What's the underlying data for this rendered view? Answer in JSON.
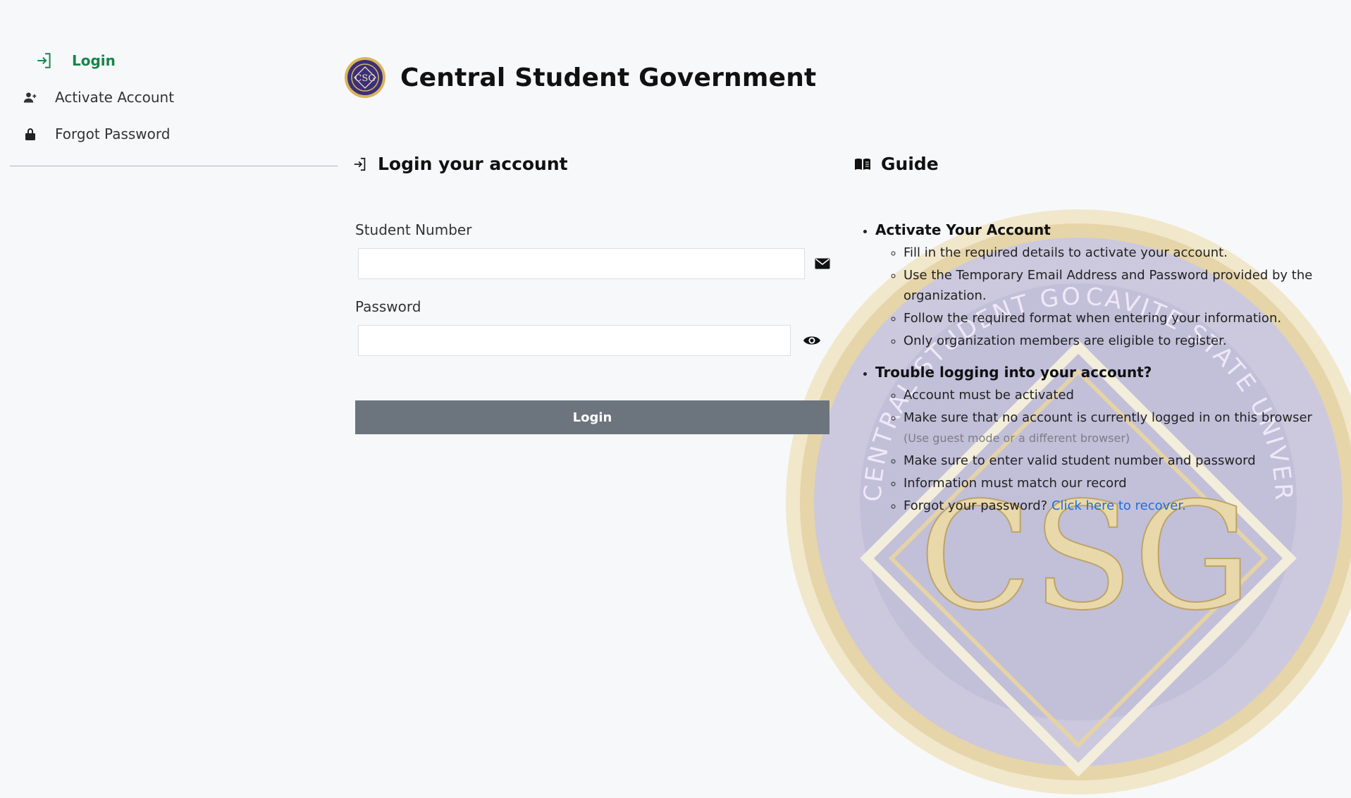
{
  "sidebar": {
    "items": [
      {
        "label": "Login",
        "icon": "login-arrow-icon",
        "active": true
      },
      {
        "label": "Activate Account",
        "icon": "person-add-icon",
        "active": false
      },
      {
        "label": "Forgot Password",
        "icon": "lock-icon",
        "active": false
      }
    ]
  },
  "header": {
    "title": "Central Student Government",
    "seal_monogram": "CSG"
  },
  "login": {
    "title": "Login your account",
    "student_number_label": "Student Number",
    "student_number_value": "",
    "password_label": "Password",
    "password_value": "",
    "submit_label": "Login"
  },
  "guide": {
    "title": "Guide",
    "sections": [
      {
        "heading": "Activate Your Account",
        "items": [
          "Fill in the required details to activate your account.",
          "Use the Temporary Email Address and Password provided by the organization.",
          "Follow the required format when entering your information.",
          "Only organization members are eligible to register."
        ]
      },
      {
        "heading": "Trouble logging into your account?",
        "items": [
          "Account must be activated",
          "Make sure that no account is currently logged in on this browser",
          "Make sure to enter valid student number and password",
          "Information must match our record",
          "Forgot your password?"
        ],
        "browser_note": "(Use guest mode or a different browser)",
        "recover_link": "Click here to recover."
      }
    ]
  },
  "watermark": {
    "monogram": "CSG",
    "ring_left": "CENTRAL STUDENT GOVERNMENT",
    "ring_right": "CAVITE STATE UNIVERSITY - IMUS"
  },
  "colors": {
    "accent_green": "#16854a",
    "button_gray": "#6c757d",
    "link_blue": "#1a6fe0",
    "seal_purple": "#3a2f7a",
    "seal_gold": "#d9b55a"
  }
}
